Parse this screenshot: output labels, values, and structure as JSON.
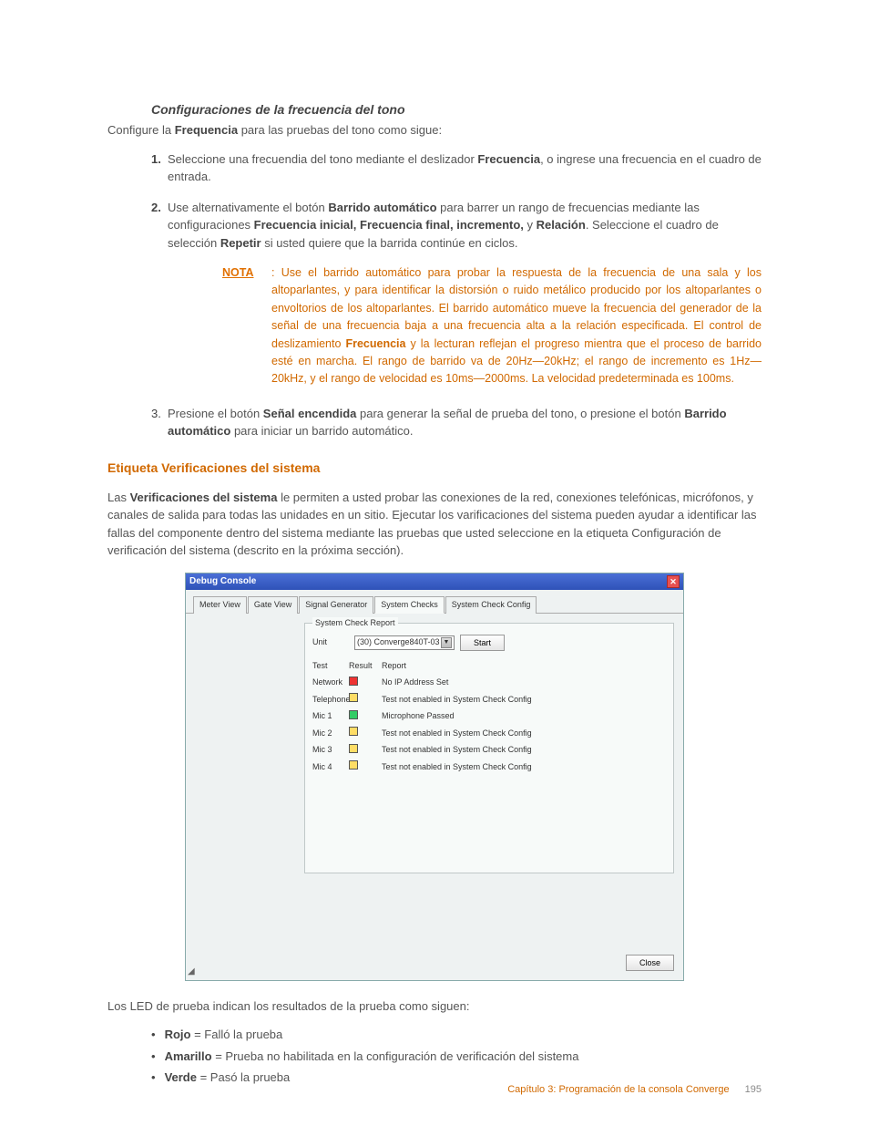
{
  "section": {
    "h3": "Configuraciones de la frecuencia del tono",
    "intro_pre": "Configure la ",
    "intro_bold": "Frequencia",
    "intro_post": " para las pruebas del tono como sigue:",
    "step1_pre": "Seleccione una frecuendia del tono mediante el deslizador ",
    "step1_b": "Frecuencia",
    "step1_post": ", o ingrese una frecuencia en el cuadro de entrada.",
    "step2_a": "Use alternativamente el botón ",
    "step2_b1": "Barrido automático",
    "step2_c": " para barrer un rango de frecuencias mediante las configuraciones ",
    "step2_b2": "Frecuencia inicial, Frecuencia final, incremento,",
    "step2_d": " y ",
    "step2_b3": "Relación",
    "step2_e": ". Seleccione el cuadro de selección ",
    "step2_b4": "Repetir",
    "step2_f": " si usted quiere que la barrida continúe en ciclos.",
    "note_label": "NOTA",
    "note_a": ": Use el barrido automático para probar la respuesta de la frecuencia de una sala y los altoparlantes, y para identificar la distorsión o ruido metálico producido por los altoparlantes o envoltorios de los altoparlantes. El barrido automático mueve la frecuencia del generador de la señal de una frecuencia baja a una frecuencia alta a la relación especificada. El control de deslizamiento ",
    "note_b": "Frecuencia",
    "note_c": " y la lecturan reflejan el progreso mientra que el proceso de barrido esté en marcha. El rango de barrido va de 20Hz—20kHz; el rango de incremento es 1Hz—20kHz, y el rango de velocidad es 10ms—2000ms. La velocidad predeterminada es 100ms.",
    "step3_a": "Presione el botón ",
    "step3_b1": "Señal encendida",
    "step3_c": " para generar la señal de prueba del tono, o presione el botón ",
    "step3_b2": "Barrido automático",
    "step3_d": " para iniciar un barrido automático."
  },
  "h2": "Etiqueta Verificaciones del sistema",
  "syschecks_para_a": "Las ",
  "syschecks_para_b": "Verificaciones del sistema",
  "syschecks_para_c": " le permiten a usted probar las conexiones de la red, conexiones telefónicas, micrófonos, y canales de salida para todas las unidades en un sitio. Ejecutar los varificaciones del sistema pueden ayudar a identificar las fallas del componente dentro del sistema mediante las pruebas que usted seleccione en la etiqueta Configuración de verificación del sistema (descrito en la próxima sección).",
  "debug": {
    "title": "Debug Console",
    "tabs": [
      "Meter View",
      "Gate View",
      "Signal Generator",
      "System Checks",
      "System Check Config"
    ],
    "active_tab_index": 3,
    "legend": "System Check Report",
    "unit_label": "Unit",
    "unit_value": "(30) Converge840T-03",
    "start_label": "Start",
    "headers": {
      "test": "Test",
      "result": "Result",
      "report": "Report"
    },
    "rows": [
      {
        "test": "Network",
        "led": "red",
        "report": "No IP Address Set"
      },
      {
        "test": "Telephone",
        "led": "yellow",
        "report": "Test not enabled in System Check Config"
      },
      {
        "test": "Mic 1",
        "led": "green",
        "report": "Microphone Passed"
      },
      {
        "test": "Mic 2",
        "led": "yellow",
        "report": "Test not enabled in System Check Config"
      },
      {
        "test": "Mic 3",
        "led": "yellow",
        "report": "Test not enabled in System Check Config"
      },
      {
        "test": "Mic 4",
        "led": "yellow",
        "report": "Test not enabled in System Check Config"
      }
    ],
    "close_label": "Close"
  },
  "led_intro": "Los LED de prueba indican los resultados de la prueba como siguen:",
  "leds": {
    "red_b": "Rojo",
    "red_t": " = Falló la prueba",
    "yellow_b": "Amarillo",
    "yellow_t": " = Prueba no habilitada en la configuración de verificación del sistema",
    "green_b": "Verde",
    "green_t": " = Pasó la prueba"
  },
  "footer": {
    "chapter": "Capítulo 3: Programación de la consola Converge",
    "page": "195"
  }
}
